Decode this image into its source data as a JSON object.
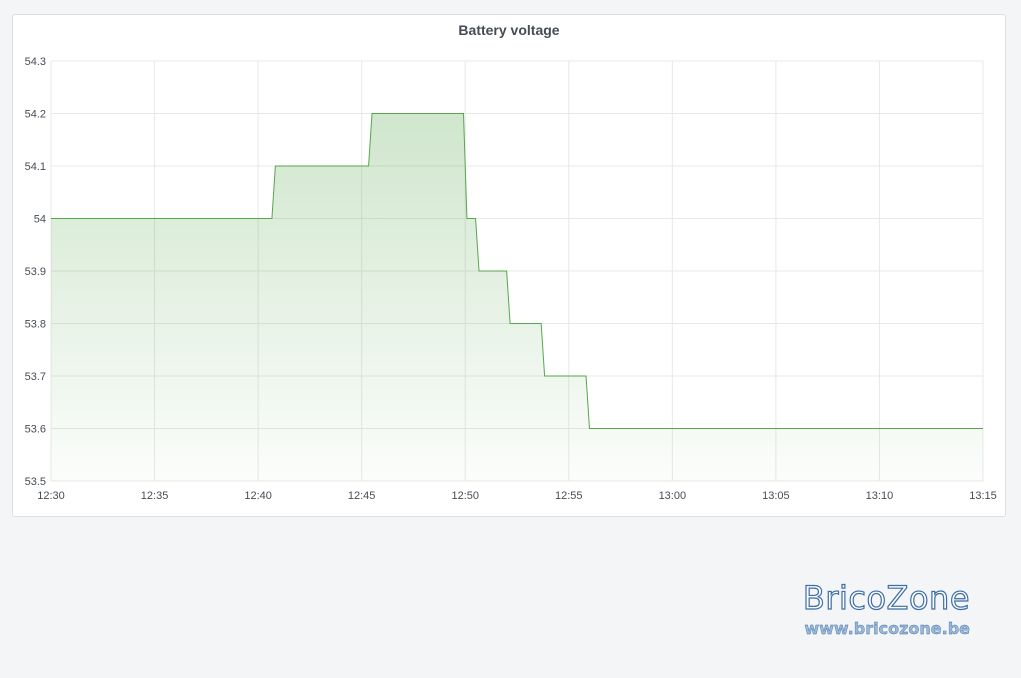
{
  "panel": {
    "title": "Battery voltage"
  },
  "watermark": {
    "title": "BricoZone",
    "url": "www.bricozone.be"
  },
  "colors": {
    "line": "#56a64b",
    "fill": "#56a64b",
    "grid": "#e8e8e8",
    "axis_text": "#464c54"
  },
  "chart_data": {
    "type": "line",
    "title": "Battery voltage",
    "xlabel": "",
    "ylabel": "",
    "x_range": [
      "12:30",
      "13:15"
    ],
    "ylim": [
      53.5,
      54.3
    ],
    "y_ticks": [
      "53.5",
      "53.6",
      "53.7",
      "53.8",
      "53.9",
      "54",
      "54.1",
      "54.2",
      "54.3"
    ],
    "x_ticks": [
      "12:30",
      "12:35",
      "12:40",
      "12:45",
      "12:50",
      "12:55",
      "13:00",
      "13:05",
      "13:10",
      "13:15"
    ],
    "grid": true,
    "legend": "none",
    "series": [
      {
        "values": [
          {
            "t": "12:30:00",
            "v": 54.0
          },
          {
            "t": "12:40:40",
            "v": 54.0
          },
          {
            "t": "12:40:50",
            "v": 54.1
          },
          {
            "t": "12:45:20",
            "v": 54.1
          },
          {
            "t": "12:45:30",
            "v": 54.2
          },
          {
            "t": "12:49:55",
            "v": 54.2
          },
          {
            "t": "12:50:05",
            "v": 54.0
          },
          {
            "t": "12:50:30",
            "v": 54.0
          },
          {
            "t": "12:50:40",
            "v": 53.9
          },
          {
            "t": "12:52:00",
            "v": 53.9
          },
          {
            "t": "12:52:10",
            "v": 53.8
          },
          {
            "t": "12:53:40",
            "v": 53.8
          },
          {
            "t": "12:53:50",
            "v": 53.7
          },
          {
            "t": "12:55:50",
            "v": 53.7
          },
          {
            "t": "12:56:00",
            "v": 53.6
          },
          {
            "t": "13:15:00",
            "v": 53.6
          }
        ]
      }
    ]
  }
}
